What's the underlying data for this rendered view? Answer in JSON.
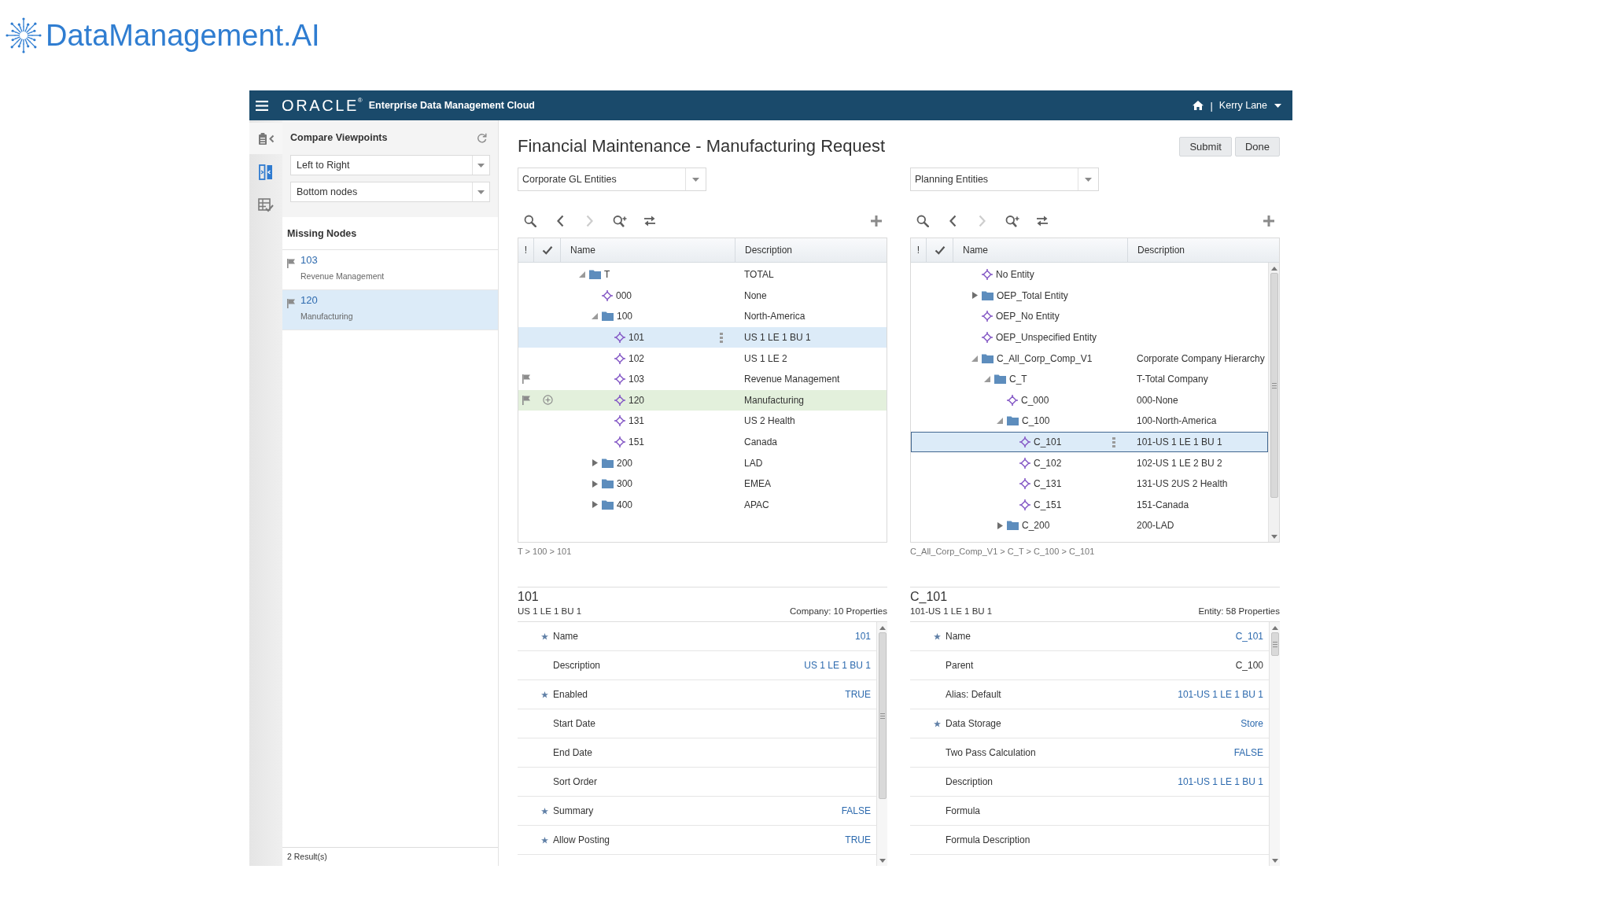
{
  "brand": {
    "name": "DataManagement.AI"
  },
  "header": {
    "logo": "ORACLE",
    "logo_mark": "®",
    "title": "Enterprise Data Management Cloud",
    "separator": "|",
    "user": "Kerry Lane"
  },
  "rail": [
    {
      "kind": "collapse",
      "selected": false
    },
    {
      "kind": "compare",
      "selected": true
    },
    {
      "kind": "validate",
      "selected": false
    }
  ],
  "sidebar": {
    "title": "Compare Viewpoints",
    "dropdowns": [
      {
        "value": "Left to Right"
      },
      {
        "value": "Bottom nodes"
      }
    ],
    "list_title": "Missing Nodes",
    "items": [
      {
        "name": "103",
        "description": "Revenue Management",
        "selected": false
      },
      {
        "name": "120",
        "description": "Manufacturing",
        "selected": true
      }
    ],
    "footer": "2 Result(s)"
  },
  "page": {
    "title": "Financial Maintenance - Manufacturing Request",
    "buttons": [
      {
        "label": "Submit"
      },
      {
        "label": "Done"
      }
    ]
  },
  "panes": [
    {
      "viewpoint": "Corporate GL Entities",
      "toolbar": [
        {
          "kind": "search",
          "disabled": false
        },
        {
          "kind": "back",
          "disabled": false
        },
        {
          "kind": "forward",
          "disabled": true
        },
        {
          "kind": "locate",
          "disabled": false
        },
        {
          "kind": "swap",
          "disabled": false
        },
        {
          "kind": "add",
          "disabled": false
        }
      ],
      "tree": {
        "focused": false,
        "scrollable": false,
        "columns": [
          {
            "kind": "flag",
            "label": "!"
          },
          {
            "kind": "check"
          },
          {
            "kind": "name",
            "label": "Name"
          },
          {
            "kind": "description",
            "label": "Description"
          }
        ],
        "rows": [
          {
            "kind": "folder",
            "name": "T",
            "description": "TOTAL",
            "expanded": true,
            "selected": false,
            "flagged": false,
            "highlighted": false,
            "addable": false,
            "children": [
              {
                "kind": "member",
                "name": "000",
                "description": "None",
                "selected": false,
                "flagged": false,
                "highlighted": false,
                "addable": false
              },
              {
                "kind": "folder",
                "name": "100",
                "description": "North-America",
                "expanded": true,
                "selected": false,
                "flagged": false,
                "highlighted": false,
                "addable": false,
                "children": [
                  {
                    "kind": "member",
                    "name": "101",
                    "description": "US 1 LE 1 BU 1",
                    "selected": true,
                    "flagged": false,
                    "highlighted": false,
                    "addable": false
                  },
                  {
                    "kind": "member",
                    "name": "102",
                    "description": "US 1 LE 2",
                    "selected": false,
                    "flagged": false,
                    "highlighted": false,
                    "addable": false
                  },
                  {
                    "kind": "member",
                    "name": "103",
                    "description": "Revenue Management",
                    "selected": false,
                    "flagged": true,
                    "highlighted": false,
                    "addable": false
                  },
                  {
                    "kind": "member",
                    "name": "120",
                    "description": "Manufacturing",
                    "selected": false,
                    "flagged": true,
                    "highlighted": true,
                    "addable": true
                  },
                  {
                    "kind": "member",
                    "name": "131",
                    "description": "US 2 Health",
                    "selected": false,
                    "flagged": false,
                    "highlighted": false,
                    "addable": false
                  },
                  {
                    "kind": "member",
                    "name": "151",
                    "description": "Canada",
                    "selected": false,
                    "flagged": false,
                    "highlighted": false,
                    "addable": false
                  }
                ]
              },
              {
                "kind": "folder",
                "name": "200",
                "description": "LAD",
                "expanded": false,
                "selected": false,
                "flagged": false,
                "highlighted": false,
                "addable": false
              },
              {
                "kind": "folder",
                "name": "300",
                "description": "EMEA",
                "expanded": false,
                "selected": false,
                "flagged": false,
                "highlighted": false,
                "addable": false
              },
              {
                "kind": "folder",
                "name": "400",
                "description": "APAC",
                "expanded": false,
                "selected": false,
                "flagged": false,
                "highlighted": false,
                "addable": false
              }
            ]
          }
        ]
      },
      "breadcrumb": "T > 100 > 101",
      "properties": {
        "title": "101",
        "subtitle": "US 1 LE 1 BU 1",
        "summary": "Company: 10 Properties",
        "rows": [
          {
            "label": "Name",
            "required": true,
            "value": "101",
            "editable": true
          },
          {
            "label": "Description",
            "required": false,
            "value": "US 1 LE 1 BU 1",
            "editable": true
          },
          {
            "label": "Enabled",
            "required": true,
            "value": "TRUE",
            "editable": true
          },
          {
            "label": "Start Date",
            "required": false
          },
          {
            "label": "End Date",
            "required": false
          },
          {
            "label": "Sort Order",
            "required": false
          },
          {
            "label": "Summary",
            "required": true,
            "value": "FALSE",
            "editable": true
          },
          {
            "label": "Allow Posting",
            "required": true,
            "value": "TRUE",
            "editable": true
          }
        ]
      }
    },
    {
      "viewpoint": "Planning Entities",
      "toolbar": [
        {
          "kind": "search",
          "disabled": false
        },
        {
          "kind": "back",
          "disabled": false
        },
        {
          "kind": "forward",
          "disabled": true
        },
        {
          "kind": "locate",
          "disabled": false
        },
        {
          "kind": "swap",
          "disabled": false
        },
        {
          "kind": "add",
          "disabled": false
        }
      ],
      "tree": {
        "focused": true,
        "scrollable": true,
        "columns": [
          {
            "kind": "flag",
            "label": "!"
          },
          {
            "kind": "check"
          },
          {
            "kind": "name",
            "label": "Name"
          },
          {
            "kind": "description",
            "label": "Description"
          }
        ],
        "rows": [
          {
            "kind": "member",
            "name": "No Entity",
            "selected": false,
            "flagged": false,
            "highlighted": false,
            "addable": false
          },
          {
            "kind": "folder",
            "name": "OEP_Total Entity",
            "expanded": false,
            "selected": false,
            "flagged": false,
            "highlighted": false,
            "addable": false
          },
          {
            "kind": "member",
            "name": "OEP_No Entity",
            "selected": false,
            "flagged": false,
            "highlighted": false,
            "addable": false
          },
          {
            "kind": "member",
            "name": "OEP_Unspecified Entity",
            "selected": false,
            "flagged": false,
            "highlighted": false,
            "addable": false
          },
          {
            "kind": "folder",
            "name": "C_All_Corp_Comp_V1",
            "description": "Corporate Company Hierarchy",
            "expanded": true,
            "selected": false,
            "flagged": false,
            "highlighted": false,
            "addable": false,
            "children": [
              {
                "kind": "folder",
                "name": "C_T",
                "description": "T-Total Company",
                "expanded": true,
                "selected": false,
                "flagged": false,
                "highlighted": false,
                "addable": false,
                "children": [
                  {
                    "kind": "member",
                    "name": "C_000",
                    "description": "000-None",
                    "selected": false,
                    "flagged": false,
                    "highlighted": false,
                    "addable": false
                  },
                  {
                    "kind": "folder",
                    "name": "C_100",
                    "description": "100-North-America",
                    "expanded": true,
                    "selected": false,
                    "flagged": false,
                    "highlighted": false,
                    "addable": false,
                    "children": [
                      {
                        "kind": "member",
                        "name": "C_101",
                        "description": "101-US 1 LE 1 BU 1",
                        "selected": true,
                        "flagged": false,
                        "highlighted": false,
                        "addable": false
                      },
                      {
                        "kind": "member",
                        "name": "C_102",
                        "description": "102-US 1 LE 2 BU 2",
                        "selected": false,
                        "flagged": false,
                        "highlighted": false,
                        "addable": false
                      },
                      {
                        "kind": "member",
                        "name": "C_131",
                        "description": "131-US 2US 2 Health",
                        "selected": false,
                        "flagged": false,
                        "highlighted": false,
                        "addable": false
                      },
                      {
                        "kind": "member",
                        "name": "C_151",
                        "description": "151-Canada",
                        "selected": false,
                        "flagged": false,
                        "highlighted": false,
                        "addable": false
                      }
                    ]
                  },
                  {
                    "kind": "folder",
                    "name": "C_200",
                    "description": "200-LAD",
                    "expanded": false,
                    "selected": false,
                    "flagged": false,
                    "highlighted": false,
                    "addable": false
                  }
                ]
              }
            ]
          }
        ]
      },
      "breadcrumb": "C_All_Corp_Comp_V1 > C_T > C_100 > C_101",
      "properties": {
        "title": "C_101",
        "subtitle": "101-US 1 LE 1 BU 1",
        "summary": "Entity: 58 Properties",
        "rows": [
          {
            "label": "Name",
            "required": true,
            "value": "C_101",
            "editable": true
          },
          {
            "label": "Parent",
            "required": false,
            "value": "C_100",
            "editable": false
          },
          {
            "label": "Alias: Default",
            "required": false,
            "value": "101-US 1 LE 1 BU 1",
            "editable": true
          },
          {
            "label": "Data Storage",
            "required": true,
            "value": "Store",
            "editable": true
          },
          {
            "label": "Two Pass Calculation",
            "required": false,
            "value": "FALSE",
            "editable": true
          },
          {
            "label": "Description",
            "required": false,
            "value": "101-US 1 LE 1 BU 1",
            "editable": true
          },
          {
            "label": "Formula",
            "required": false
          },
          {
            "label": "Formula Description",
            "required": false
          }
        ]
      }
    }
  ]
}
